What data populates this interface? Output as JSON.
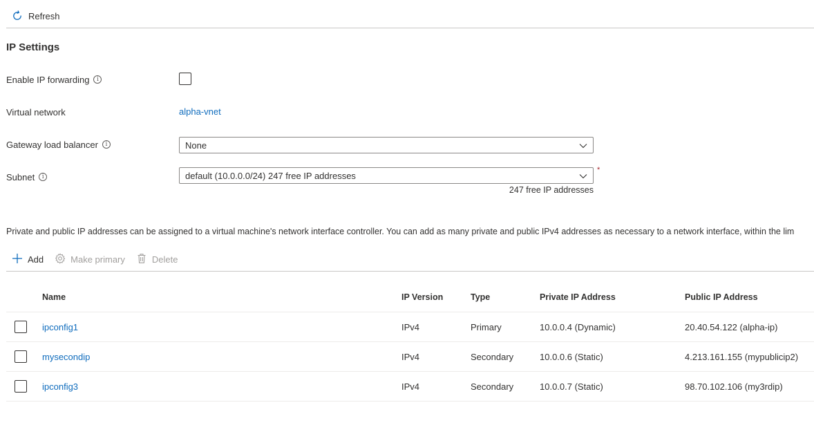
{
  "toolbar": {
    "refresh_label": "Refresh"
  },
  "section": {
    "title": "IP Settings"
  },
  "form": {
    "ip_forwarding": {
      "label": "Enable IP forwarding",
      "checked": false
    },
    "virtual_network": {
      "label": "Virtual network",
      "value": "alpha-vnet"
    },
    "gateway_lb": {
      "label": "Gateway load balancer",
      "value": "None"
    },
    "subnet": {
      "label": "Subnet",
      "value": "default (10.0.0.0/24) 247 free IP addresses",
      "help": "247 free IP addresses",
      "required_mark": "*"
    }
  },
  "description": "Private and public IP addresses can be assigned to a virtual machine's network interface controller. You can add as many private and public IPv4 addresses as necessary to a network interface, within the lim",
  "commands": {
    "add": "Add",
    "make_primary": "Make primary",
    "delete": "Delete"
  },
  "table": {
    "columns": {
      "name": "Name",
      "version": "IP Version",
      "type": "Type",
      "private": "Private IP Address",
      "public": "Public IP Address"
    },
    "rows": [
      {
        "name": "ipconfig1",
        "version": "IPv4",
        "type": "Primary",
        "private": "10.0.0.4 (Dynamic)",
        "public": "20.40.54.122 (alpha-ip)"
      },
      {
        "name": "mysecondip",
        "version": "IPv4",
        "type": "Secondary",
        "private": "10.0.0.6 (Static)",
        "public": "4.213.161.155 (mypublicip2)"
      },
      {
        "name": "ipconfig3",
        "version": "IPv4",
        "type": "Secondary",
        "private": "10.0.0.7 (Static)",
        "public": "98.70.102.106 (my3rdip)"
      }
    ]
  },
  "colors": {
    "link": "#0f6cbd",
    "text": "#323130",
    "disabled": "#a19f9d",
    "border": "#c8c6c4"
  }
}
